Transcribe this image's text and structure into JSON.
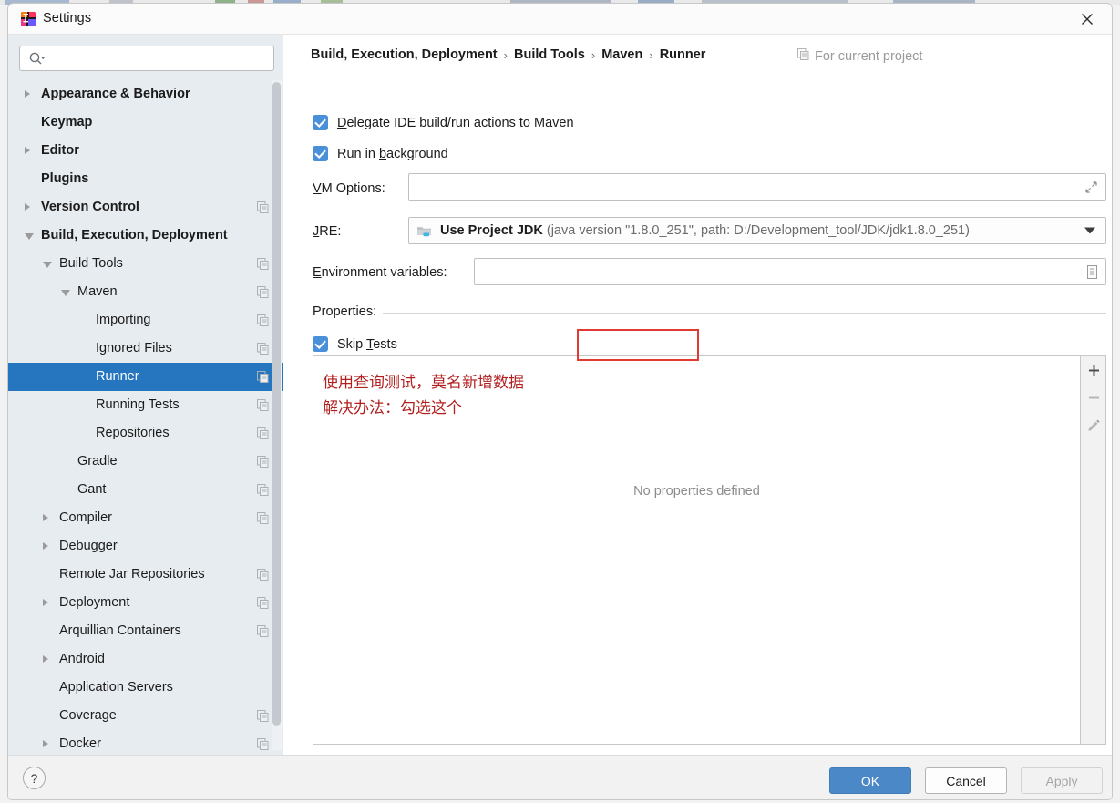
{
  "window": {
    "title": "Settings",
    "app_icon": "intellij-idea-icon",
    "close_icon": "close-icon"
  },
  "sidebar": {
    "search": {
      "placeholder": "",
      "value": "",
      "icon": "search-icon"
    },
    "items": [
      {
        "label": "Appearance & Behavior",
        "indent": 0,
        "bold": true,
        "arrow": "collapsed",
        "copy": false
      },
      {
        "label": "Keymap",
        "indent": 0,
        "bold": true,
        "arrow": "none",
        "copy": false
      },
      {
        "label": "Editor",
        "indent": 0,
        "bold": true,
        "arrow": "collapsed",
        "copy": false
      },
      {
        "label": "Plugins",
        "indent": 0,
        "bold": true,
        "arrow": "none",
        "copy": false
      },
      {
        "label": "Version Control",
        "indent": 0,
        "bold": true,
        "arrow": "collapsed",
        "copy": true
      },
      {
        "label": "Build, Execution, Deployment",
        "indent": 0,
        "bold": true,
        "arrow": "expanded",
        "copy": false
      },
      {
        "label": "Build Tools",
        "indent": 1,
        "bold": false,
        "arrow": "expanded",
        "copy": true
      },
      {
        "label": "Maven",
        "indent": 2,
        "bold": false,
        "arrow": "expanded",
        "copy": true
      },
      {
        "label": "Importing",
        "indent": 3,
        "bold": false,
        "arrow": "none",
        "copy": true
      },
      {
        "label": "Ignored Files",
        "indent": 3,
        "bold": false,
        "arrow": "none",
        "copy": true
      },
      {
        "label": "Runner",
        "indent": 3,
        "bold": false,
        "arrow": "none",
        "copy": true,
        "selected": true
      },
      {
        "label": "Running Tests",
        "indent": 3,
        "bold": false,
        "arrow": "none",
        "copy": true
      },
      {
        "label": "Repositories",
        "indent": 3,
        "bold": false,
        "arrow": "none",
        "copy": true
      },
      {
        "label": "Gradle",
        "indent": 2,
        "bold": false,
        "arrow": "none",
        "copy": true
      },
      {
        "label": "Gant",
        "indent": 2,
        "bold": false,
        "arrow": "none",
        "copy": true
      },
      {
        "label": "Compiler",
        "indent": 1,
        "bold": false,
        "arrow": "collapsed",
        "copy": true
      },
      {
        "label": "Debugger",
        "indent": 1,
        "bold": false,
        "arrow": "collapsed",
        "copy": false
      },
      {
        "label": "Remote Jar Repositories",
        "indent": 1,
        "bold": false,
        "arrow": "none",
        "copy": true
      },
      {
        "label": "Deployment",
        "indent": 1,
        "bold": false,
        "arrow": "collapsed",
        "copy": true
      },
      {
        "label": "Arquillian Containers",
        "indent": 1,
        "bold": false,
        "arrow": "none",
        "copy": true
      },
      {
        "label": "Android",
        "indent": 1,
        "bold": false,
        "arrow": "collapsed",
        "copy": false
      },
      {
        "label": "Application Servers",
        "indent": 1,
        "bold": false,
        "arrow": "none",
        "copy": false
      },
      {
        "label": "Coverage",
        "indent": 1,
        "bold": false,
        "arrow": "none",
        "copy": true
      },
      {
        "label": "Docker",
        "indent": 1,
        "bold": false,
        "arrow": "collapsed",
        "copy": true
      }
    ]
  },
  "main": {
    "breadcrumb": [
      "Build, Execution, Deployment",
      "Build Tools",
      "Maven",
      "Runner"
    ],
    "breadcrumb_separator": "›",
    "for_current_project": "For current project",
    "for_current_project_icon": "copy-settings-icon",
    "checkboxes": [
      {
        "label_pre": "",
        "label_mnemonic": "D",
        "label_post": "elegate IDE build/run actions to Maven",
        "checked": true
      },
      {
        "label_pre": "Run in ",
        "label_mnemonic": "b",
        "label_post": "ackground",
        "checked": true
      }
    ],
    "vm_options": {
      "label_pre": "",
      "label_mnemonic": "V",
      "label_post": "M Options:",
      "value": "",
      "expand_icon": "expand-arrows-icon"
    },
    "jre": {
      "label_pre": "",
      "label_mnemonic": "J",
      "label_post": "RE:",
      "icon": "folder-icon",
      "value": "Use Project JDK",
      "detail": "(java version \"1.8.0_251\", path: D:/Development_tool/JDK/jdk1.8.0_251)",
      "dropdown_icon": "chevron-down-icon"
    },
    "env_vars": {
      "label_pre": "",
      "label_mnemonic": "E",
      "label_post": "nvironment variables:",
      "value": "",
      "browse_icon": "list-document-icon"
    },
    "properties_label": "Properties:",
    "skip_tests": {
      "label_pre": "Skip ",
      "label_mnemonic": "T",
      "label_post": "ests",
      "checked": true,
      "highlight_color": "#e03a32"
    },
    "properties_empty": "No properties defined",
    "annotation": {
      "line1": "使用查询测试，莫名新增数据",
      "line2": "解决办法：勾选这个",
      "color": "#b21f1f"
    },
    "toolbar": [
      {
        "icon": "plus-icon",
        "enabled": true
      },
      {
        "icon": "minus-icon",
        "enabled": false
      },
      {
        "icon": "pencil-edit-icon",
        "enabled": false
      }
    ]
  },
  "footer": {
    "help": "?",
    "ok": "OK",
    "cancel": "Cancel",
    "apply": "Apply",
    "ok_color": "#4a88c7"
  }
}
